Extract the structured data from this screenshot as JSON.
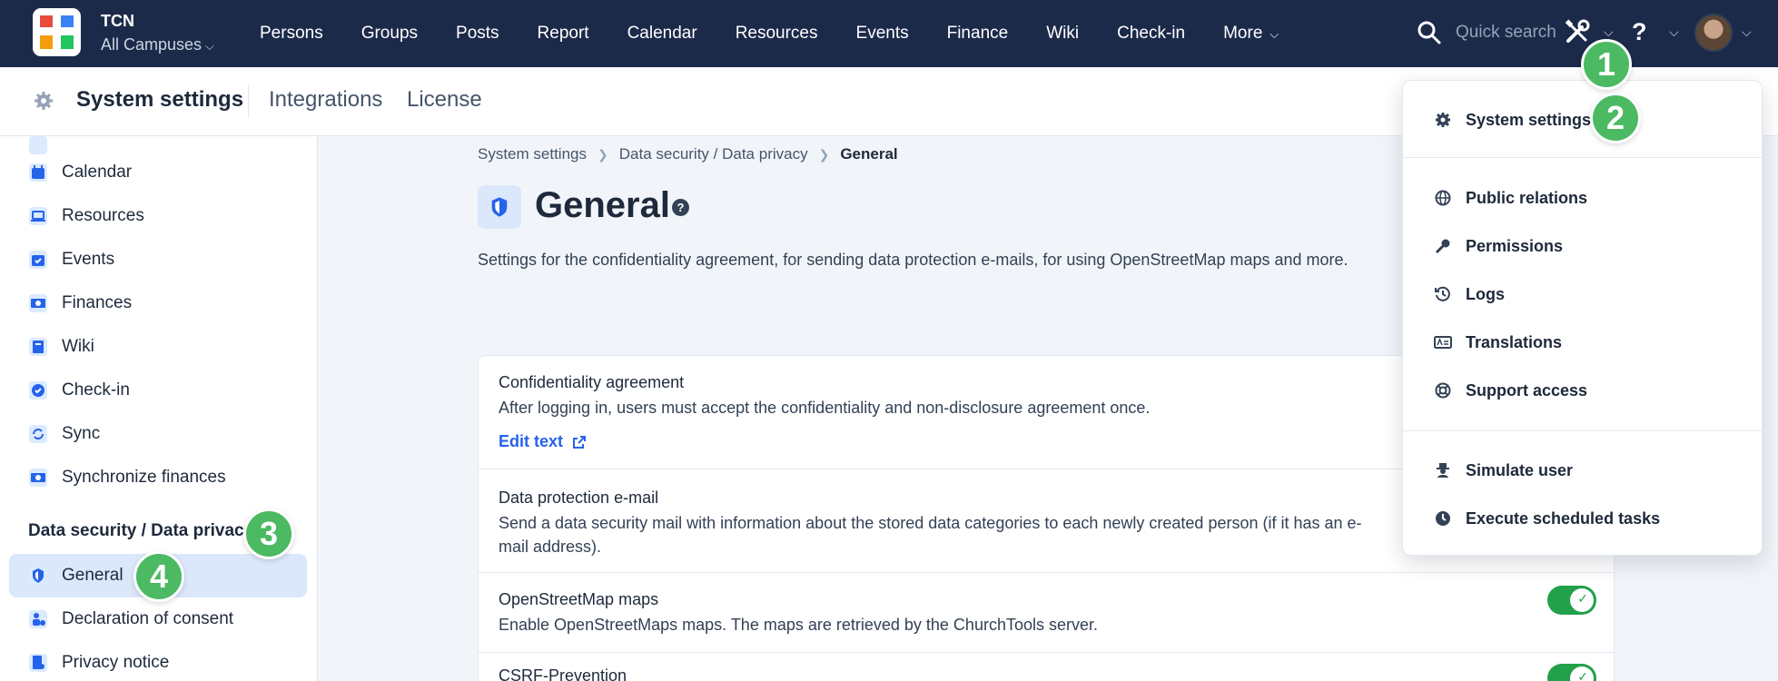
{
  "topbar": {
    "org_name": "TCN",
    "campus": "All Campuses",
    "nav": [
      "Persons",
      "Groups",
      "Posts",
      "Report",
      "Calendar",
      "Resources",
      "Events",
      "Finance",
      "Wiki",
      "Check-in",
      "More"
    ],
    "quick_search": "Quick search",
    "help": "?"
  },
  "subheader": {
    "title": "System settings",
    "links": [
      "Integrations",
      "License"
    ]
  },
  "sidebar": {
    "items": [
      {
        "label": "Calendar",
        "icon": "calendar-icon"
      },
      {
        "label": "Resources",
        "icon": "laptop-icon"
      },
      {
        "label": "Events",
        "icon": "calendar-check-icon"
      },
      {
        "label": "Finances",
        "icon": "money-icon"
      },
      {
        "label": "Wiki",
        "icon": "book-icon"
      },
      {
        "label": "Check-in",
        "icon": "check-circle-icon"
      },
      {
        "label": "Sync",
        "icon": "sync-icon"
      },
      {
        "label": "Synchronize finances",
        "icon": "money-sync-icon"
      }
    ],
    "section": "Data security / Data privacy",
    "section_items": [
      {
        "label": "General",
        "icon": "shield-icon"
      },
      {
        "label": "Declaration of consent",
        "icon": "person-check-icon"
      },
      {
        "label": "Privacy notice",
        "icon": "document-icon"
      }
    ]
  },
  "breadcrumb": [
    "System settings",
    "Data security / Data privacy",
    "General"
  ],
  "page": {
    "title": "General",
    "description": "Settings for the confidentiality agreement, for sending data protection e-mails, for using OpenStreetMap maps and more."
  },
  "settings": [
    {
      "title": "Confidentiality agreement",
      "desc": "After logging in, users must accept the confidentiality and non-disclosure agreement once.",
      "link": "Edit text"
    },
    {
      "title": "Data protection e-mail",
      "desc": "Send a data security mail with information about the stored data categories to each newly created person (if it has an e-mail address)."
    },
    {
      "title": "OpenStreetMap maps",
      "desc": "Enable OpenStreetMaps maps. The maps are retrieved by the ChurchTools server.",
      "enabled": true
    },
    {
      "title": "CSRF-Prevention",
      "enabled": true
    }
  ],
  "dropdown": {
    "groups": [
      [
        {
          "label": "System settings",
          "icon": "gear-icon"
        }
      ],
      [
        {
          "label": "Public relations",
          "icon": "globe-icon"
        },
        {
          "label": "Permissions",
          "icon": "key-icon"
        },
        {
          "label": "Logs",
          "icon": "history-icon"
        },
        {
          "label": "Translations",
          "icon": "translate-icon"
        },
        {
          "label": "Support access",
          "icon": "lifebuoy-icon"
        }
      ],
      [
        {
          "label": "Simulate user",
          "icon": "spy-icon"
        },
        {
          "label": "Execute scheduled tasks",
          "icon": "clock-icon"
        }
      ]
    ]
  },
  "badges": [
    "1",
    "2",
    "3",
    "4"
  ],
  "colors": {
    "nav_bg": "#1c2a4a",
    "accent": "#2563eb",
    "badge": "#4cb963",
    "toggle": "#22a04a"
  }
}
